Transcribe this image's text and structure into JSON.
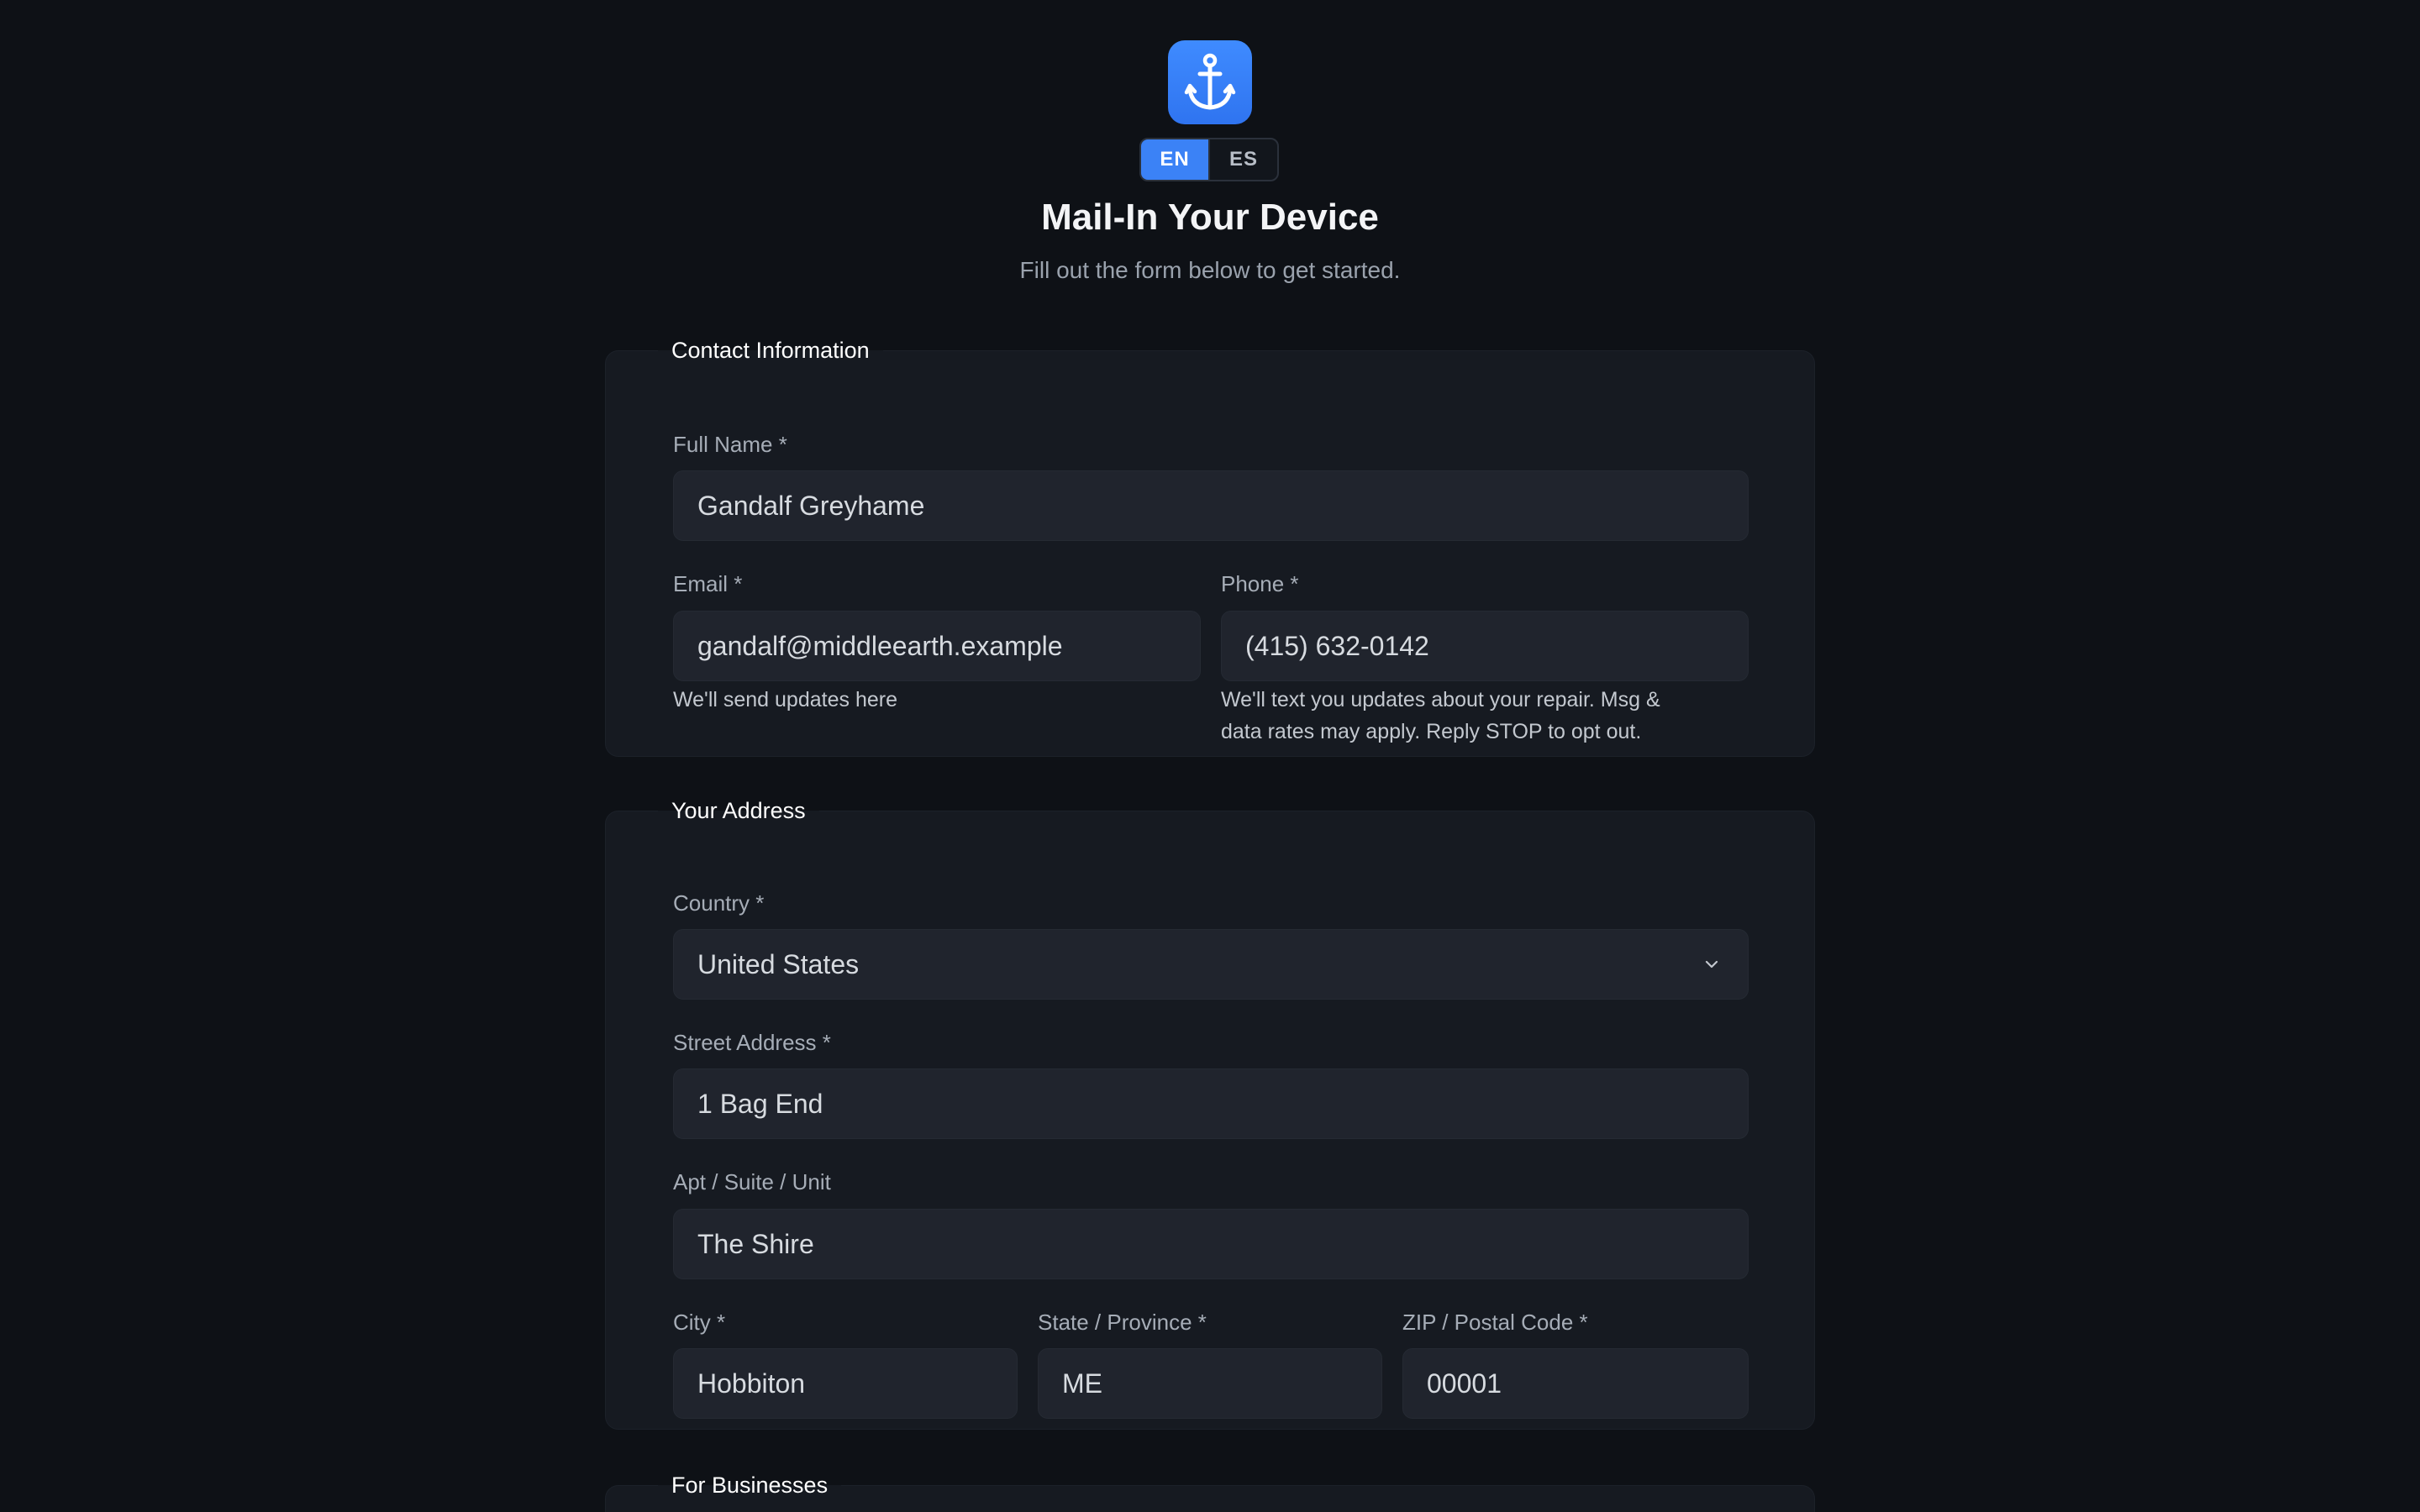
{
  "header": {
    "logo_icon": "anchor-icon",
    "languages": [
      "EN",
      "ES"
    ],
    "active_language": "EN",
    "title": "Mail-In Your Device",
    "subtitle": "Fill out the form below to get started."
  },
  "contact": {
    "legend": "Contact Information",
    "full_name_label": "Full Name *",
    "full_name_value": "Gandalf Greyhame",
    "email_label": "Email *",
    "email_value": "gandalf@middleearth.example",
    "email_hint": "We'll send updates here",
    "phone_label": "Phone *",
    "phone_value": "(415) 632-0142",
    "phone_hint_line1": "We'll text you updates about your repair. Msg &",
    "phone_hint_line2": "data rates may apply. Reply STOP to opt out."
  },
  "address": {
    "legend": "Your Address",
    "country_label": "Country *",
    "country_value": "United States",
    "street_label": "Street Address *",
    "street_value": "1 Bag End",
    "apt_label": "Apt / Suite / Unit",
    "apt_value": "The Shire",
    "city_label": "City *",
    "city_value": "Hobbiton",
    "state_label": "State / Province *",
    "state_value": "ME",
    "zip_label": "ZIP / Postal Code *",
    "zip_value": "00001"
  },
  "business": {
    "legend": "For Businesses"
  },
  "colors": {
    "background": "#0e1116",
    "card": "#161a21",
    "input": "#20242d",
    "accent": "#3b82f6"
  }
}
